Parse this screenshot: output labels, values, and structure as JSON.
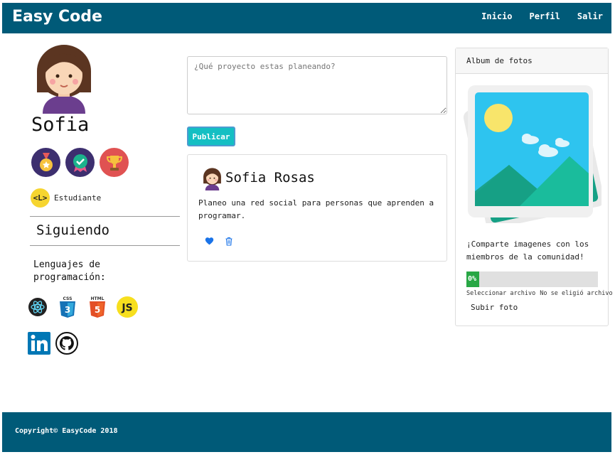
{
  "navbar": {
    "brand": "Easy Code",
    "links": [
      "Inicio",
      "Perfil",
      "Salir"
    ],
    "background": "#005a78"
  },
  "profile": {
    "name": "Sofia",
    "badges": [
      "medal-badge",
      "ribbon-badge",
      "trophy-badge"
    ],
    "level_icon_text": "<L>",
    "level": "Estudiante",
    "following_label": "Siguiendo",
    "languages_title": "Lenguajes de programación:",
    "language_icons": [
      "react-icon",
      "css3-icon",
      "html5-icon",
      "javascript-icon"
    ],
    "social_icons": [
      "linkedin-icon",
      "github-icon"
    ],
    "js_label": "JS",
    "css_label": "CSS",
    "html_label": "HTML"
  },
  "composer": {
    "placeholder": "¿Qué proyecto estas planeando?",
    "publish_label": "Publicar",
    "accent": "#14bfc3"
  },
  "post": {
    "author": "Sofia Rosas",
    "text": "Planeo una red social para personas que aprenden a programar.",
    "actions": [
      "heart-icon",
      "trash-icon"
    ]
  },
  "album": {
    "header": "Album de fotos",
    "text": "¡Comparte imagenes con los miembros de la comunidad!",
    "progress_label": "0%",
    "progress_value": 0,
    "file_button": "Seleccionar archivo",
    "file_status": "No se eligió archivo",
    "upload_label": "Subir foto"
  },
  "footer": {
    "copyright": "Copyright© EasyCode 2018"
  }
}
